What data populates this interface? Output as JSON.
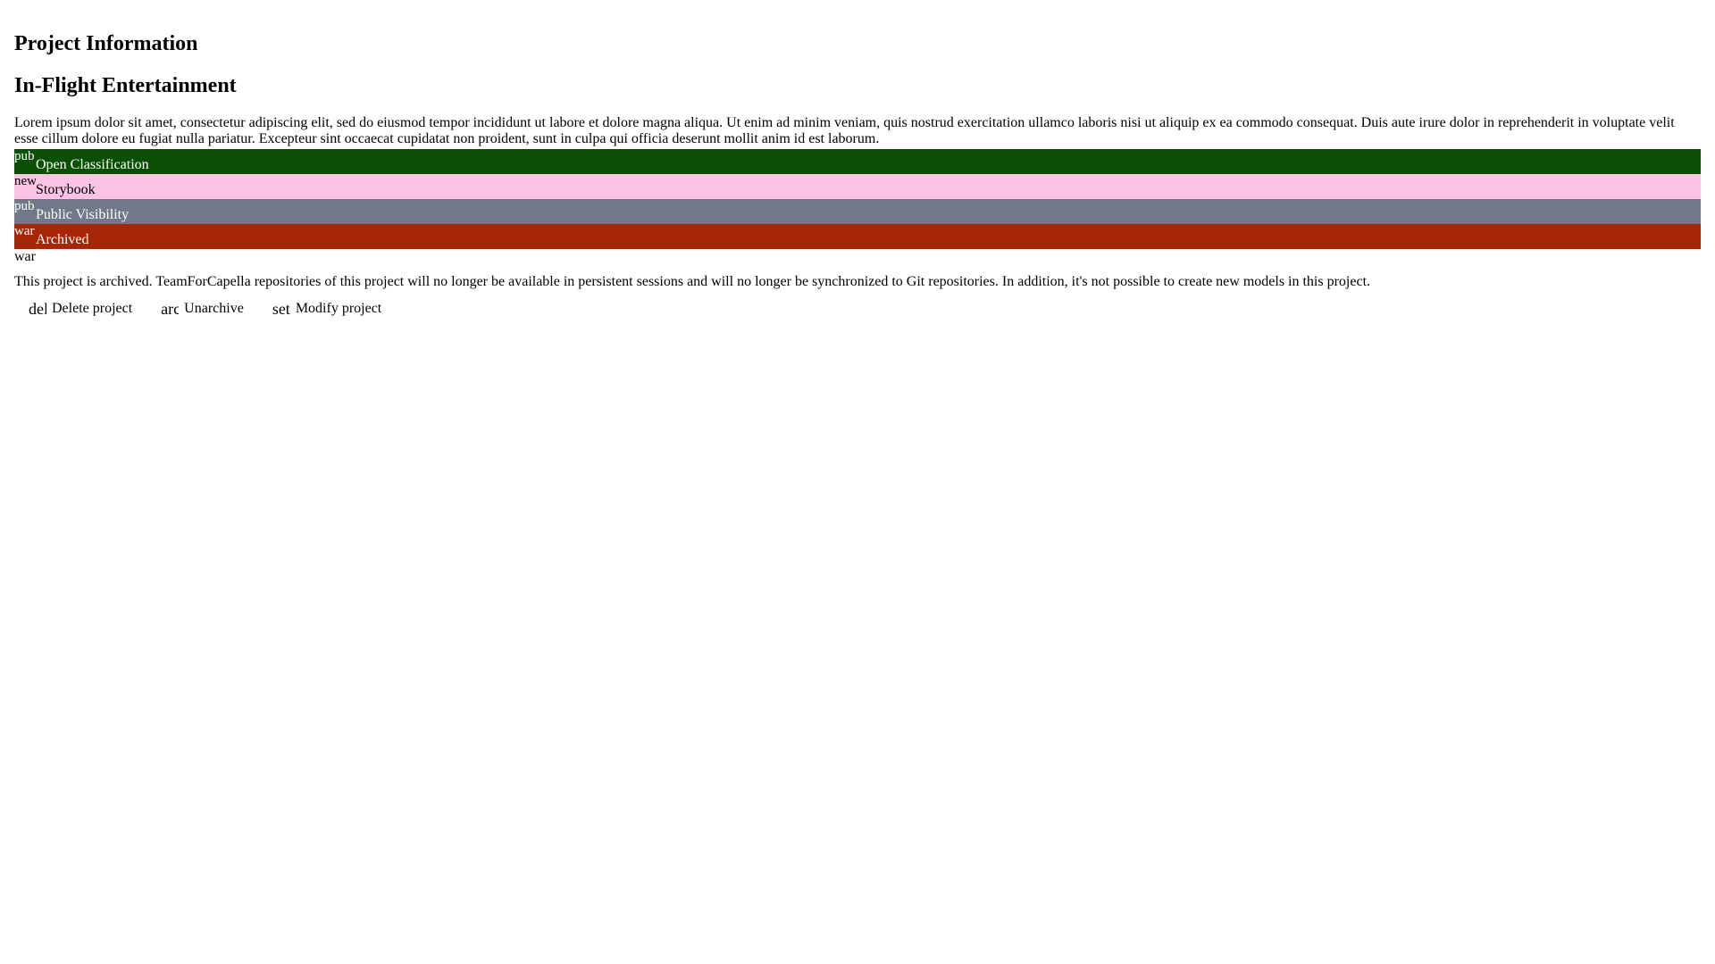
{
  "page_title": "Project Information",
  "project_name": "In-Flight Entertainment",
  "description": "Lorem ipsum dolor sit amet, consectetur adipiscing elit, sed do eiusmod tempor incididunt ut labore et dolore magna aliqua. Ut enim ad minim veniam, quis nostrud exercitation ullamco laboris nisi ut aliquip ex ea commodo consequat. Duis aute irure dolor in reprehenderit in voluptate velit esse cillum dolore eu fugiat nulla pariatur. Excepteur sint occaecat cupidatat non proident, sunt in culpa qui officia deserunt mollit anim id est laborum.",
  "badges": [
    {
      "icon": "pub",
      "label": "Open Classification",
      "bg": "#0a4f04",
      "fg": "#ffffff"
    },
    {
      "icon": "new",
      "label": "Storybook",
      "bg": "#fbc3e4",
      "fg": "#000000"
    },
    {
      "icon": "pub",
      "label": "Public Visibility",
      "bg": "#707889",
      "fg": "#ffffff"
    },
    {
      "icon": "war",
      "label": "Archived",
      "bg": "#a62607",
      "fg": "#ffffff"
    }
  ],
  "warning_icon": "war",
  "archive_notice": "This project is archived. TeamForCapella repositories of this project will no longer be available in persistent sessions and will no longer be synchronized to Git repositories. In addition, it's not possible to create new models in this project.",
  "actions": [
    {
      "icon": "delete",
      "label": "Delete project"
    },
    {
      "icon": "archive",
      "label": "Unarchive"
    },
    {
      "icon": "settings",
      "label": "Modify project"
    }
  ]
}
